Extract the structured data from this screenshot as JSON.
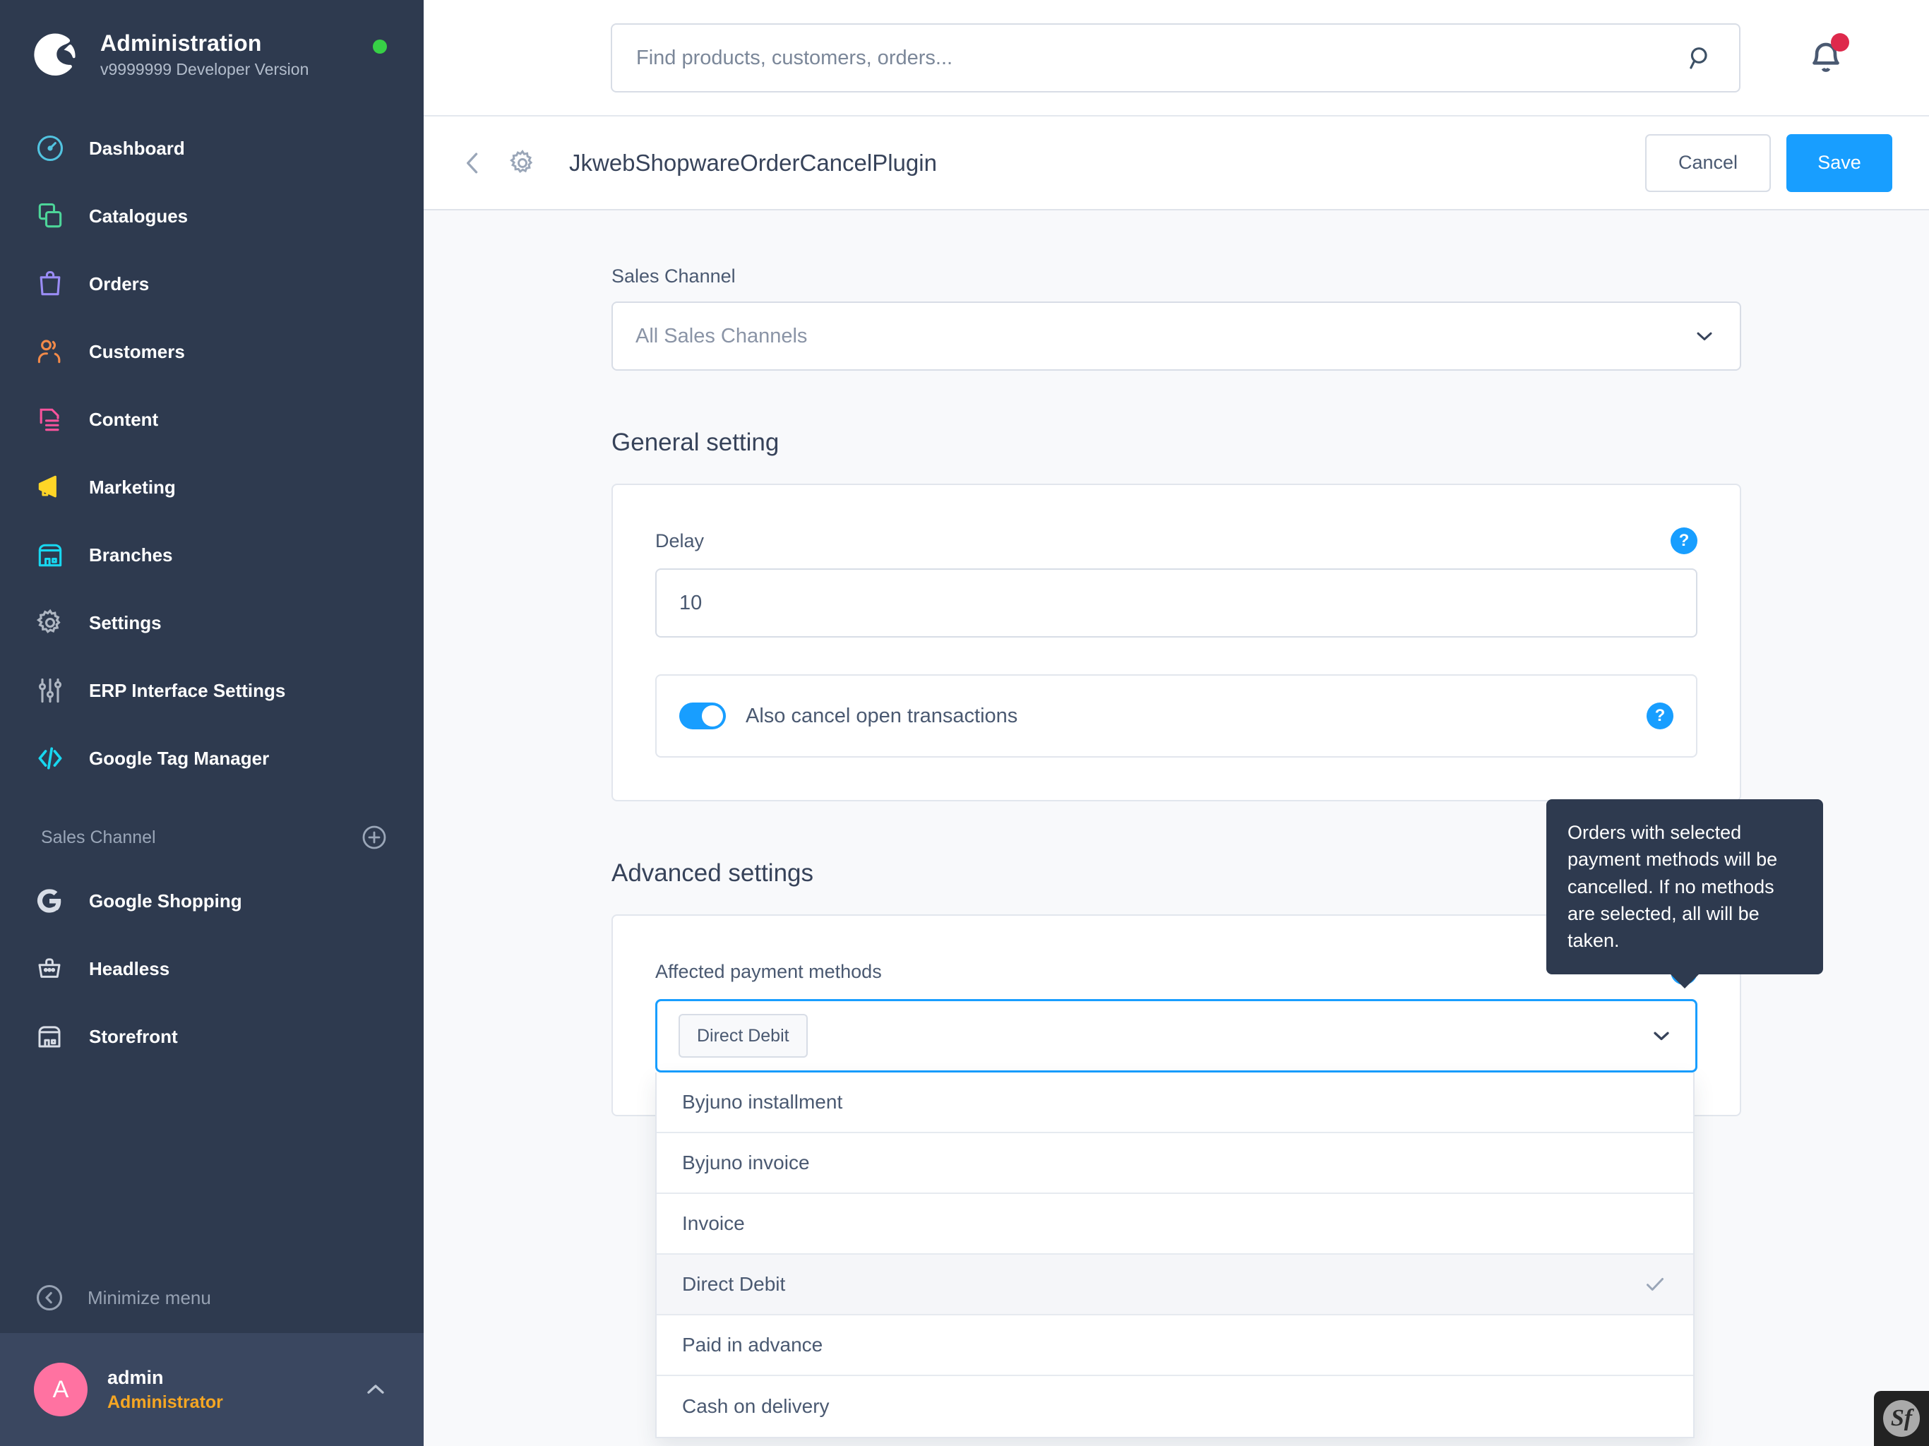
{
  "sidebar": {
    "title": "Administration",
    "version": "v9999999 Developer Version",
    "status_color": "#37d046",
    "nav": [
      {
        "label": "Dashboard",
        "icon": "gauge-icon",
        "color": "#52c3e0"
      },
      {
        "label": "Catalogues",
        "icon": "copy-icon",
        "color": "#4dd599"
      },
      {
        "label": "Orders",
        "icon": "bag-icon",
        "color": "#9a8cf5"
      },
      {
        "label": "Customers",
        "icon": "users-icon",
        "color": "#f28a49"
      },
      {
        "label": "Content",
        "icon": "content-icon",
        "color": "#f7539c"
      },
      {
        "label": "Marketing",
        "icon": "megaphone-icon",
        "color": "#ffd527"
      },
      {
        "label": "Branches",
        "icon": "store-icon",
        "color": "#18d7f0"
      },
      {
        "label": "Settings",
        "icon": "gear-icon",
        "color": "#aeb6c2"
      },
      {
        "label": "ERP Interface Settings",
        "icon": "sliders-icon",
        "color": "#aeb6c2"
      },
      {
        "label": "Google Tag Manager",
        "icon": "code-icon",
        "color": "#18d7f0"
      }
    ],
    "sales_channel": {
      "title": "Sales Channel",
      "add_icon": "plus-circle-icon",
      "items": [
        {
          "label": "Google Shopping",
          "icon": "google-icon"
        },
        {
          "label": "Headless",
          "icon": "basket-icon"
        },
        {
          "label": "Storefront",
          "icon": "store-icon"
        }
      ]
    },
    "minimize": {
      "label": "Minimize menu",
      "icon": "chevron-left-circle-icon"
    },
    "user": {
      "avatar_initial": "A",
      "avatar_color": "#ff72a1",
      "name": "admin",
      "role": "Administrator",
      "role_color": "#f5a623",
      "caret_icon": "chevron-up-icon"
    }
  },
  "topbar": {
    "search": {
      "placeholder": "Find products, customers, orders...",
      "value": "",
      "icon": "search-icon"
    },
    "notifications": {
      "icon": "bell-icon",
      "has_unread": true,
      "dot_color": "#de294c"
    }
  },
  "toolbar": {
    "back_icon": "chevron-left-icon",
    "gear_icon": "gear-icon",
    "title": "JkwebShopwareOrderCancelPlugin",
    "cancel_label": "Cancel",
    "save_label": "Save",
    "save_color": "#189eff"
  },
  "main": {
    "sales_channel": {
      "label": "Sales Channel",
      "value": "All Sales Channels",
      "caret_icon": "chevron-down-icon"
    },
    "general": {
      "section_title": "General setting",
      "delay": {
        "label": "Delay",
        "value": "10",
        "help_icon": "question-badge-icon"
      },
      "cancel_transactions": {
        "label": "Also cancel open transactions",
        "enabled": true,
        "toggle_color": "#189eff",
        "help_icon": "question-badge-icon"
      }
    },
    "advanced": {
      "section_title": "Advanced settings",
      "payment_methods": {
        "label": "Affected payment methods",
        "help_icon": "question-badge-icon",
        "selected_chips": [
          "Direct Debit"
        ],
        "caret_icon": "chevron-down-icon",
        "dropdown_open": true,
        "options": [
          {
            "label": "Byjuno installment",
            "selected": false
          },
          {
            "label": "Byjuno invoice",
            "selected": false
          },
          {
            "label": "Invoice",
            "selected": false
          },
          {
            "label": "Direct Debit",
            "selected": true
          },
          {
            "label": "Paid in advance",
            "selected": false
          },
          {
            "label": "Cash on delivery",
            "selected": false
          }
        ]
      }
    }
  },
  "tooltip": {
    "text": "Orders with selected payment methods will be cancelled. If no methods are selected, all will be taken."
  },
  "debug_badge": {
    "label": "Sf",
    "name": "symfony-toolbar-badge"
  }
}
